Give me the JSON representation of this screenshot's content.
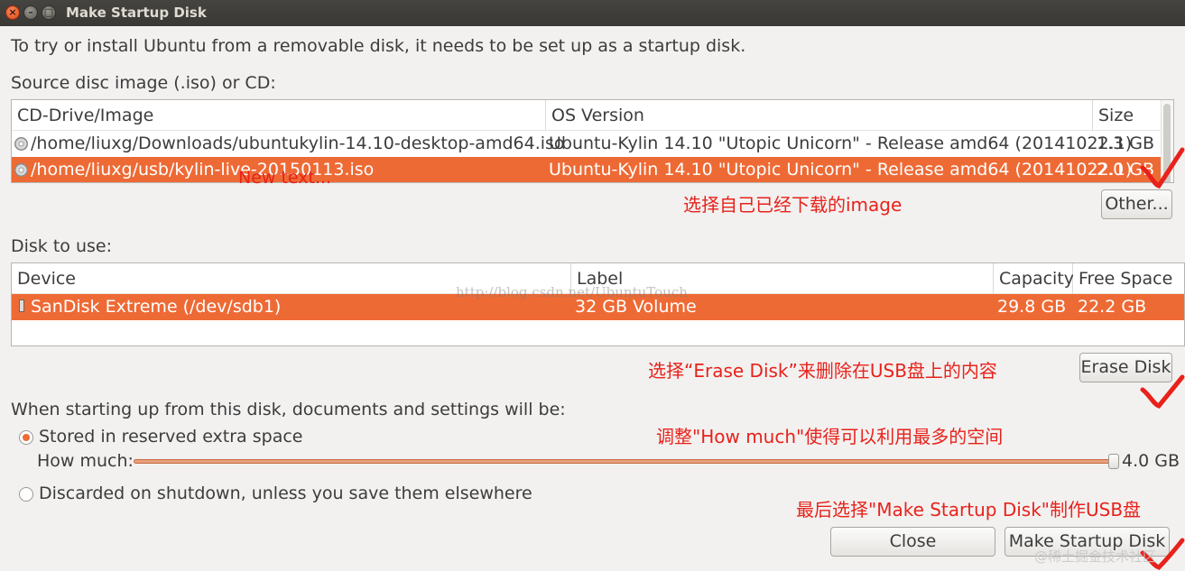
{
  "window": {
    "title": "Make Startup Disk",
    "close_glyph": "×",
    "min_glyph": "–",
    "max_glyph": "□"
  },
  "intro": "To try or install Ubuntu from a removable disk, it needs to be set up as a startup disk.",
  "source": {
    "label": "Source disc image (.iso) or CD:",
    "columns": [
      "CD-Drive/Image",
      "OS Version",
      "Size"
    ],
    "rows": [
      {
        "image": "/home/liuxg/Downloads/ubuntukylin-14.10-desktop-amd64.iso",
        "os": "Ubuntu-Kylin 14.10 \"Utopic Unicorn\" - Release amd64 (20141022.1)",
        "size": "1.3 GB",
        "selected": false
      },
      {
        "image": "/home/liuxg/usb/kylin-live-20150113.iso",
        "os": "Ubuntu-Kylin 14.10 \"Utopic Unicorn\" - Release amd64 (20141022.1)",
        "size": "2.0 GB",
        "selected": true
      }
    ],
    "other_button": "Other..."
  },
  "disk": {
    "label": "Disk to use:",
    "columns": [
      "Device",
      "Label",
      "Capacity",
      "Free Space"
    ],
    "rows": [
      {
        "device": "SanDisk Extreme (/dev/sdb1)",
        "label": "32 GB Volume",
        "capacity": "29.8 GB",
        "free": "22.2 GB",
        "selected": true
      }
    ],
    "erase_button": "Erase Disk"
  },
  "persistence": {
    "label": "When starting up from this disk, documents and settings will be:",
    "option_stored": "Stored in reserved extra space",
    "how_much_label": "How much:",
    "how_much_value": "4.0 GB",
    "slider_fraction": 1.0,
    "option_discarded": "Discarded on shutdown, unless you save them elsewhere",
    "selected_option": "stored"
  },
  "buttons": {
    "close": "Close",
    "make": "Make Startup Disk"
  },
  "annotations": {
    "new_text": "New text...",
    "choose_image": "选择自己已经下载的image",
    "erase": "选择“Erase Disk”来删除在USB盘上的内容",
    "how_much": "调整\"How much\"使得可以利用最多的空间",
    "make": "最后选择\"Make Startup Disk\"制作USB盘"
  },
  "watermark": "http://blog.csdn.net/UbuntuTouch",
  "corner_watermark": "@稀土掘金技术社区",
  "colors": {
    "selection": "#ee6a35",
    "annotation": "#e8221b",
    "titlebar": "#3c3b37"
  }
}
